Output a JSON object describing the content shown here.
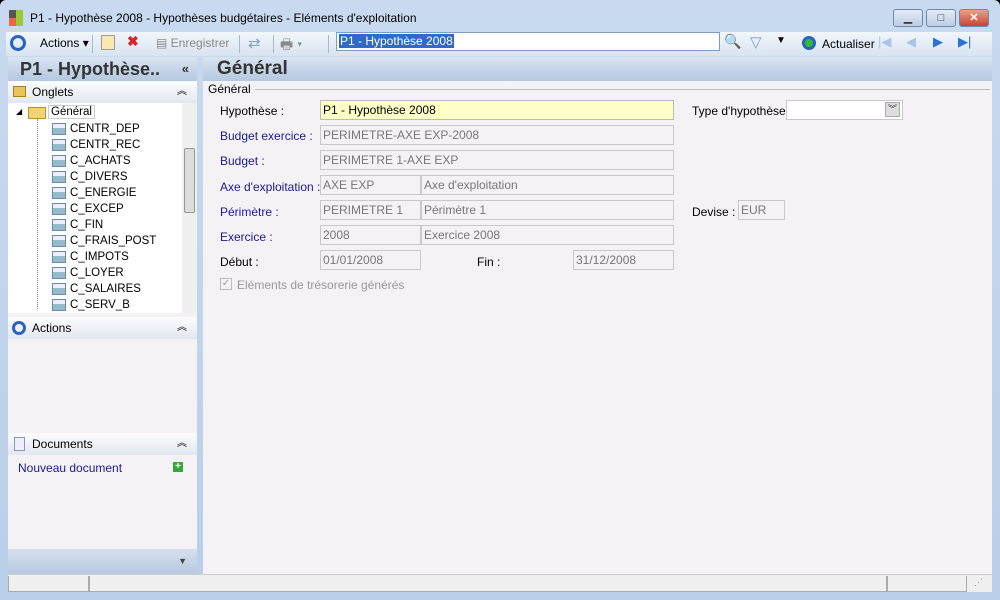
{
  "window": {
    "title": "P1 - Hypothèse 2008 -  Hypothèses budgétaires - Eléments d'exploitation",
    "minimize": "▁",
    "maximize": "□",
    "close": "✕"
  },
  "toolbar": {
    "actions": "Actions",
    "save": "Enregistrer",
    "search_value": "P1 - Hypothèse 2008",
    "refresh": "Actualiser"
  },
  "left": {
    "title": "P1 - Hypothèse..",
    "collapse": "«",
    "onglets": "Onglets",
    "root": "Général",
    "items": [
      "CENTR_DEP",
      "CENTR_REC",
      "C_ACHATS",
      "C_DIVERS",
      "C_ENERGIE",
      "C_EXCEP",
      "C_FIN",
      "C_FRAIS_POST",
      "C_IMPOTS",
      "C_LOYER",
      "C_SALAIRES",
      "C_SERV_B"
    ],
    "actions": "Actions",
    "documents": "Documents",
    "new_doc": "Nouveau document"
  },
  "main": {
    "title": "Général",
    "group": "Général",
    "hypothese_label": "Hypothèse :",
    "hypothese": "P1 - Hypothèse 2008",
    "type_label": "Type d'hypothèse :",
    "type": "",
    "budget_ex_label": "Budget exercice :",
    "budget_ex": "PERIMETRE-AXE EXP-2008",
    "budget_label": "Budget :",
    "budget": "PERIMETRE 1-AXE EXP",
    "axe_label": "Axe d'exploitation :",
    "axe_code": "AXE EXP",
    "axe_name": "Axe d'exploitation",
    "perimetre_label": "Périmètre :",
    "perimetre_code": "PERIMETRE 1",
    "perimetre_name": "Périmètre 1",
    "devise_label": "Devise :",
    "devise": "EUR",
    "exercice_label": "Exercice :",
    "exercice_code": "2008",
    "exercice_name": "Exercice 2008",
    "debut_label": "Début :",
    "debut": "01/01/2008",
    "fin_label": "Fin :",
    "fin": "31/12/2008",
    "treso_label": "Eléments de trésorerie générés",
    "treso_checked": true
  }
}
